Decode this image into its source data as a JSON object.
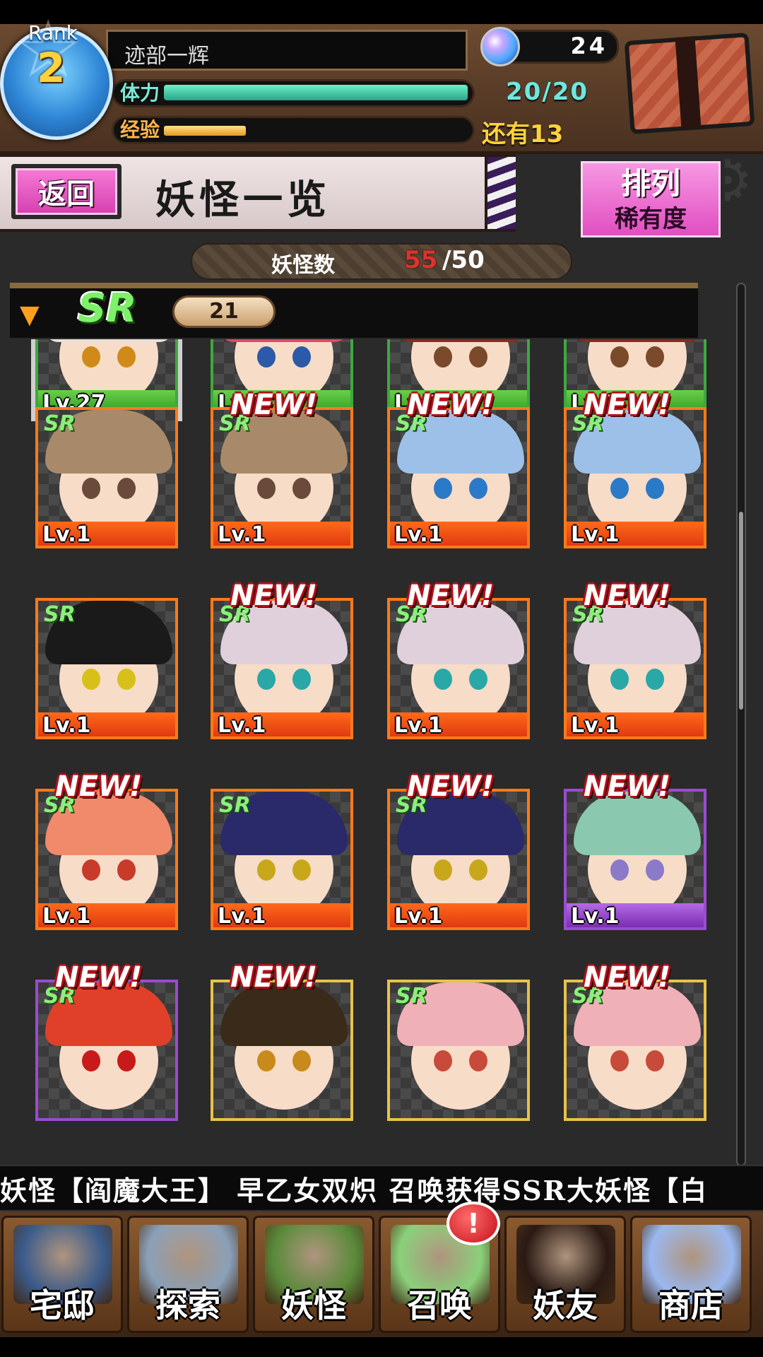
{
  "player": {
    "rank_label": "Rank",
    "rank": "2",
    "name": "迹部一辉",
    "stamina_label": "体力",
    "stamina_value": "20/20",
    "stamina_fraction": 1.0,
    "exp_label": "经验",
    "exp_remaining": "还有13",
    "exp_fraction": 0.27,
    "gems": "24"
  },
  "title_bar": {
    "back_label": "返回",
    "page_title": "妖怪一览",
    "sort_label": "排列",
    "sort_value": "稀有度"
  },
  "count": {
    "label": "妖怪数",
    "current": "55",
    "rest": "/50"
  },
  "rarity_group": {
    "label": "SR",
    "count": "21"
  },
  "cards": [
    {
      "lv": "Lv.27",
      "sr": "",
      "new": false,
      "hair": "#e8e0d8",
      "eye": "#d08a1a",
      "border": "gold",
      "base": "green-base",
      "selected": true
    },
    {
      "lv": "Lv.1",
      "sr": "",
      "new": false,
      "hair": "#e04a68",
      "eye": "#2a5aa8",
      "border": "gold",
      "base": "green-base",
      "selected": false
    },
    {
      "lv": "Lv.1",
      "sr": "",
      "new": false,
      "hair": "#8a2a22",
      "eye": "#7a4a2a",
      "border": "gold",
      "base": "green-base",
      "selected": false
    },
    {
      "lv": "Lv.1",
      "sr": "",
      "new": false,
      "hair": "#8a2a22",
      "eye": "#7a4a2a",
      "border": "gold",
      "base": "green-base",
      "selected": false
    },
    {
      "lv": "Lv.1",
      "sr": "SR",
      "new": false,
      "hair": "#a88a6a",
      "eye": "#6a4a3a",
      "border": "",
      "base": "",
      "selected": false
    },
    {
      "lv": "Lv.1",
      "sr": "SR",
      "new": true,
      "hair": "#a88a6a",
      "eye": "#6a4a3a",
      "border": "",
      "base": "",
      "selected": false
    },
    {
      "lv": "Lv.1",
      "sr": "SR",
      "new": true,
      "hair": "#9cc0e8",
      "eye": "#2a7ac8",
      "border": "",
      "base": "",
      "selected": false
    },
    {
      "lv": "Lv.1",
      "sr": "SR",
      "new": true,
      "hair": "#9cc0e8",
      "eye": "#2a7ac8",
      "border": "",
      "base": "",
      "selected": false
    },
    {
      "lv": "Lv.1",
      "sr": "SR",
      "new": false,
      "hair": "#1a1a1a",
      "eye": "#d8c01a",
      "border": "",
      "base": "",
      "selected": false
    },
    {
      "lv": "Lv.1",
      "sr": "SR",
      "new": true,
      "hair": "#e0d0dc",
      "eye": "#2aa8a8",
      "border": "",
      "base": "",
      "selected": false
    },
    {
      "lv": "Lv.1",
      "sr": "SR",
      "new": true,
      "hair": "#e0d0dc",
      "eye": "#2aa8a8",
      "border": "",
      "base": "",
      "selected": false
    },
    {
      "lv": "Lv.1",
      "sr": "SR",
      "new": true,
      "hair": "#e0d0dc",
      "eye": "#2aa8a8",
      "border": "",
      "base": "",
      "selected": false
    },
    {
      "lv": "Lv.1",
      "sr": "SR",
      "new": true,
      "hair": "#f08a6a",
      "eye": "#c83a2a",
      "border": "",
      "base": "",
      "selected": false
    },
    {
      "lv": "Lv.1",
      "sr": "SR",
      "new": false,
      "hair": "#2a2a6a",
      "eye": "#c8a81a",
      "border": "",
      "base": "",
      "selected": false
    },
    {
      "lv": "Lv.1",
      "sr": "SR",
      "new": true,
      "hair": "#2a2a6a",
      "eye": "#c8a81a",
      "border": "",
      "base": "",
      "selected": false
    },
    {
      "lv": "Lv.1",
      "sr": "",
      "new": true,
      "hair": "#8ac8b0",
      "eye": "#8a7ac8",
      "border": "purple",
      "base": "purple",
      "selected": false
    },
    {
      "lv": "",
      "sr": "SR",
      "new": true,
      "hair": "#e0402a",
      "eye": "#c81a1a",
      "border": "purple",
      "base": "",
      "selected": false
    },
    {
      "lv": "",
      "sr": "",
      "new": true,
      "hair": "#3a2a1a",
      "eye": "#c88a1a",
      "border": "gold",
      "base": "",
      "selected": false
    },
    {
      "lv": "",
      "sr": "SR",
      "new": false,
      "hair": "#f0b0b8",
      "eye": "#c84a3a",
      "border": "gold",
      "base": "",
      "selected": false
    },
    {
      "lv": "",
      "sr": "SR",
      "new": true,
      "hair": "#f0b0b8",
      "eye": "#c84a3a",
      "border": "gold",
      "base": "",
      "selected": false
    }
  ],
  "new_label": "NEW!",
  "ticker": "妖怪【阎魔大王】      早乙女双炽 召唤获得SSR大妖怪【白",
  "nav": [
    {
      "label": "宅邸",
      "icon": "mansion-icon",
      "color": "#3a5a8a"
    },
    {
      "label": "探索",
      "icon": "magnifier-map-icon",
      "color": "#8aa0b8"
    },
    {
      "label": "妖怪",
      "icon": "scroll-icon",
      "color": "#5a8a3a"
    },
    {
      "label": "召唤",
      "icon": "pentagram-icon",
      "color": "#8ad07a"
    },
    {
      "label": "妖友",
      "icon": "friend-girl-icon",
      "color": "#2a1a14"
    },
    {
      "label": "商店",
      "icon": "crystal-orb-icon",
      "color": "#9ab8f0"
    }
  ],
  "summon_alert": "!",
  "colors": {
    "accent_pink": "#e04cc0",
    "stamina": "#27a58a",
    "exp": "#e89a1f",
    "count_over": "#e0312b",
    "sr_green": "#7ef06a"
  }
}
